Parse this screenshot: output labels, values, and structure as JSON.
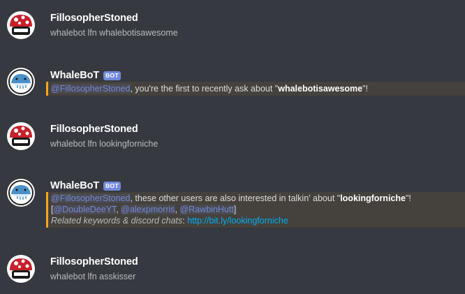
{
  "users": {
    "user": "FillosopherStoned",
    "bot": "WhaleBoT",
    "bot_tag": "BOT"
  },
  "messages": [
    {
      "author": "FillosopherStoned",
      "text": "whalebot lfn whalebotisawesome"
    },
    {
      "author": "WhaleBoT",
      "bot_tag": "BOT",
      "mention": "@FillosopherStoned",
      "text_a": ", you're the first to recently ask about \"",
      "keyword": "whalebotisawesome",
      "text_b": "\"!"
    },
    {
      "author": "FillosopherStoned",
      "text": "whalebot lfn lookingforniche"
    },
    {
      "author": "WhaleBoT",
      "bot_tag": "BOT",
      "mention": "@FillosopherStoned",
      "text_a": ", these other users are also interested in talkin' about \"",
      "keyword": "lookingforniche",
      "text_b": "\"!",
      "bracket_open": "[",
      "mentions": [
        "@DoubleDeeYT",
        "@alexpmorris",
        "@RawbinHutt"
      ],
      "separator": ", ",
      "bracket_close": "]",
      "related_label": "Related keywords & discord chats",
      "related_colon": ":",
      "link": "http://bit.ly/lookingforniche"
    },
    {
      "author": "FillosopherStoned",
      "text": "whalebot lfn asskisser"
    }
  ],
  "colors": {
    "background": "#36393f",
    "mention": "#7289da",
    "highlight_border": "#faa61a",
    "link": "#00b0f4",
    "avatar_mushroom": "#c8202a",
    "avatar_whale": "#4a90c8"
  },
  "icons": {
    "user_avatar": "mushroom-avatar-icon",
    "bot_avatar": "whale-avatar-icon"
  }
}
